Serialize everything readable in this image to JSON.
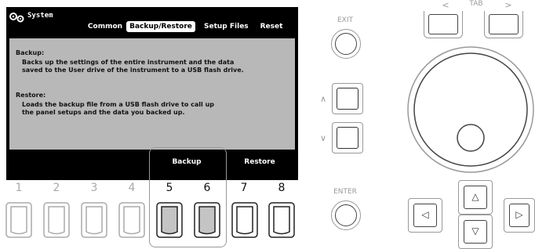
{
  "screen": {
    "title": "System",
    "tabs": [
      {
        "label": "Common",
        "active": false
      },
      {
        "label": "Backup/Restore",
        "active": true
      },
      {
        "label": "Setup Files",
        "active": false
      },
      {
        "label": "Reset",
        "active": false
      }
    ],
    "backup": {
      "heading": "Backup:",
      "line1": "Backs up the settings of the entire instrument and the data",
      "line2": "saved to the User drive of the instrument to a USB flash drive."
    },
    "restore": {
      "heading": "Restore:",
      "line1": "Loads the backup file from a USB flash drive to call up",
      "line2": "the panel setups and the data you backed up."
    },
    "softkeys": {
      "backup": "Backup",
      "restore": "Restore"
    }
  },
  "buttons": {
    "numbers": [
      "1",
      "2",
      "3",
      "4",
      "5",
      "6",
      "7",
      "8"
    ],
    "highlighted": [
      "5",
      "6"
    ]
  },
  "panel": {
    "exit_label": "EXIT",
    "enter_label": "ENTER",
    "tab_label": "TAB",
    "tab_left": "<",
    "tab_right": ">",
    "up_label": "∧",
    "down_label": "∨",
    "arrows": {
      "up": "△",
      "down": "▽",
      "left": "◁",
      "right": "▷"
    }
  },
  "colors": {
    "lcd_bg": "#000000",
    "content_bg": "#b8b8b8",
    "frame": "#999999"
  }
}
